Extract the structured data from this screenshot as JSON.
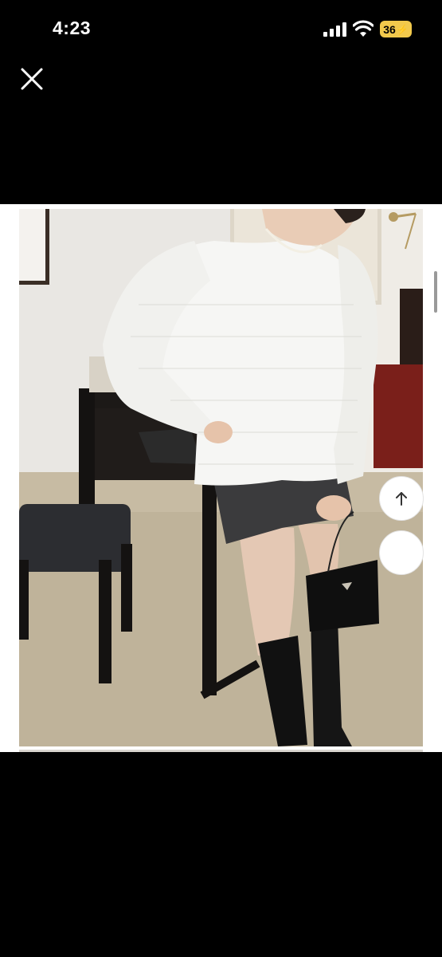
{
  "status_bar": {
    "time": "4:23",
    "battery_level": "36",
    "icons": [
      "cellular-signal-icon",
      "wifi-icon",
      "battery-charging-icon"
    ]
  },
  "toolbar": {
    "close_icon": "close-icon"
  },
  "photo": {
    "description_icon": "product-photo"
  },
  "floating_buttons": {
    "scroll_top_icon": "arrow-up-icon"
  },
  "colors": {
    "background": "#000000",
    "battery": "#f2c94c",
    "button": "#ffffff"
  }
}
